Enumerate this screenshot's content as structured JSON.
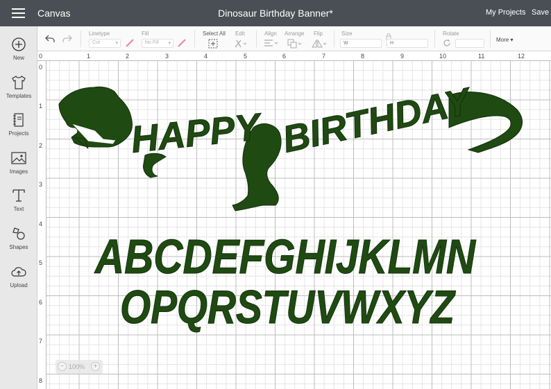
{
  "header": {
    "app_title": "Canvas",
    "document_title": "Dinosaur Birthday Banner*",
    "my_projects": "My Projects",
    "save": "Save"
  },
  "sidebar": {
    "items": [
      {
        "label": "New",
        "icon": "plus-circle-icon"
      },
      {
        "label": "Templates",
        "icon": "tshirt-icon"
      },
      {
        "label": "Projects",
        "icon": "notebook-icon"
      },
      {
        "label": "Images",
        "icon": "image-icon"
      },
      {
        "label": "Text",
        "icon": "text-t-icon"
      },
      {
        "label": "Shapes",
        "icon": "shapes-icon"
      },
      {
        "label": "Upload",
        "icon": "cloud-upload-icon"
      }
    ]
  },
  "toolbar": {
    "linetype_label": "Linetype",
    "linetype_value": "Cut",
    "fill_label": "Fill",
    "fill_value": "No Fill",
    "select_all": "Select All",
    "edit": "Edit",
    "align": "Align",
    "arrange": "Arrange",
    "flip": "Flip",
    "size": "Size",
    "width_placeholder": "W",
    "height_placeholder": "H",
    "rotate": "Rotate",
    "more": "More"
  },
  "rulers": {
    "top": [
      "0",
      "1",
      "2",
      "3",
      "4",
      "5",
      "6",
      "7",
      "8",
      "9",
      "10",
      "11",
      "12"
    ],
    "left": [
      "0",
      "1",
      "2",
      "3",
      "4",
      "5",
      "6",
      "7",
      "8"
    ]
  },
  "canvas": {
    "banner_words": [
      "HAPPY",
      "BIRTHDAY"
    ],
    "alphabet_row_1": "ABCDEFGHIJKLMN",
    "alphabet_row_2": "OPQRSTUVWXYZ",
    "design_color": "#1f4a12"
  },
  "zoom": {
    "value": "100%",
    "minus": "−",
    "plus": "+"
  },
  "colors": {
    "topbar": "#4a4f55",
    "sidebar": "#e8e8e8",
    "design_green": "#1f4a12",
    "pen_pink": "#e88aa0"
  }
}
